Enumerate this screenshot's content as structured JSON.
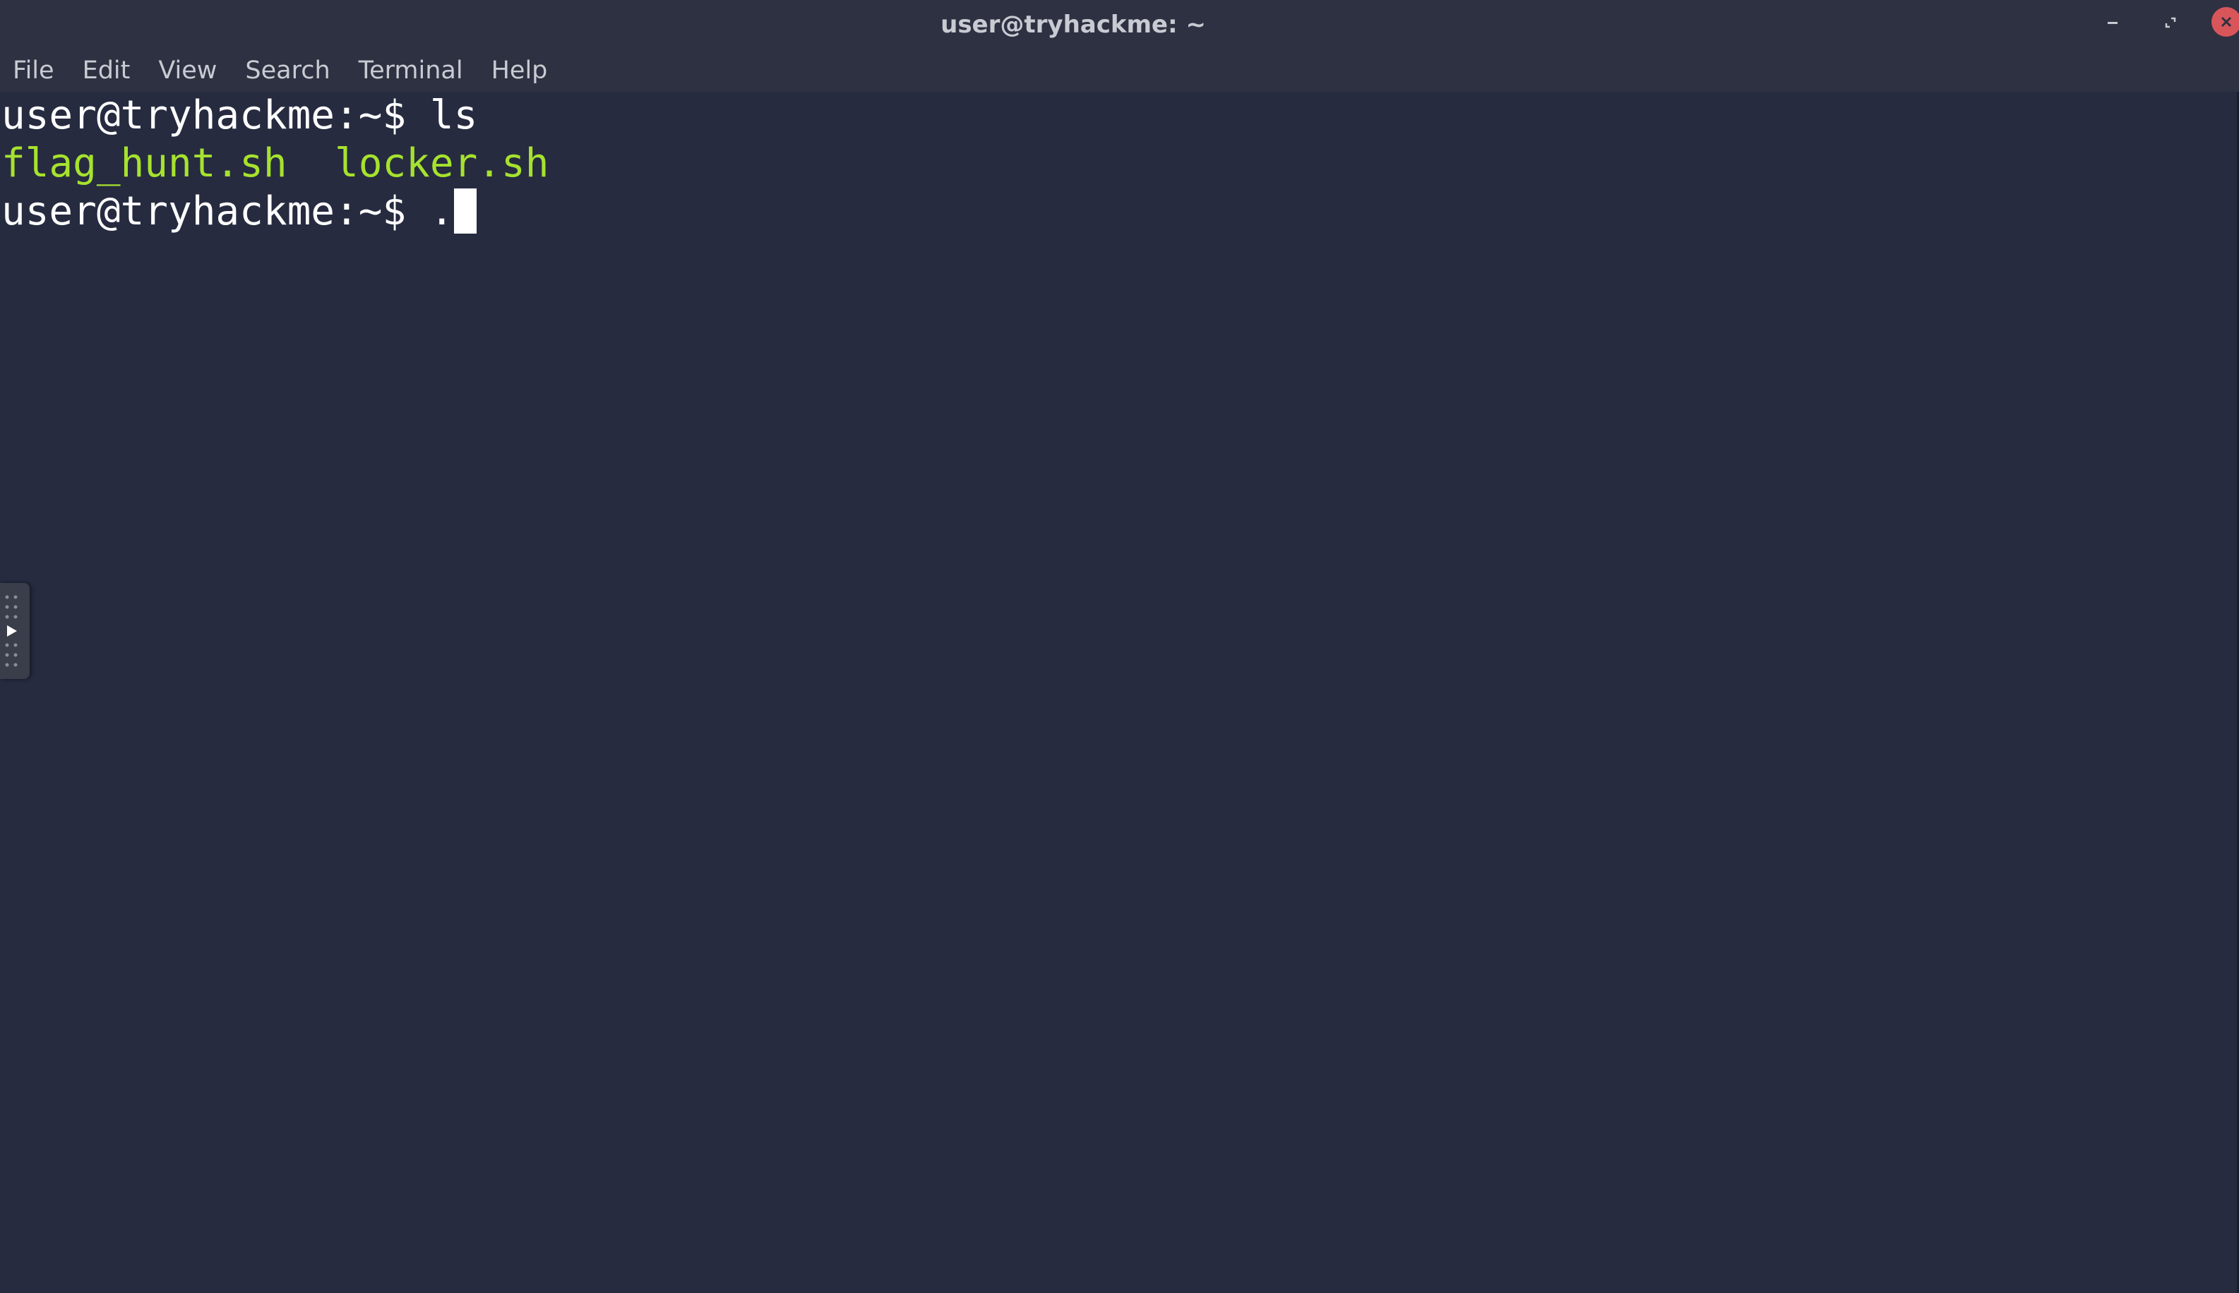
{
  "window": {
    "title": "user@tryhackme: ~",
    "controls": {
      "minimize_icon": "minimize-icon",
      "maximize_icon": "maximize-icon",
      "close_icon": "close-icon",
      "close_color": "#d8565a"
    }
  },
  "menu": {
    "items": [
      "File",
      "Edit",
      "View",
      "Search",
      "Terminal",
      "Help"
    ]
  },
  "terminal": {
    "background": "#262b40",
    "lines": [
      {
        "prompt": "user@tryhackme:~$ ",
        "command": "ls"
      },
      {
        "files": [
          "flag_hunt.sh",
          "locker.sh"
        ],
        "separator": "  ",
        "color": "#a6e22e"
      },
      {
        "prompt": "user@tryhackme:~$ ",
        "command": "."
      }
    ]
  },
  "side_handle": {
    "icon": "play-arrow-icon"
  }
}
